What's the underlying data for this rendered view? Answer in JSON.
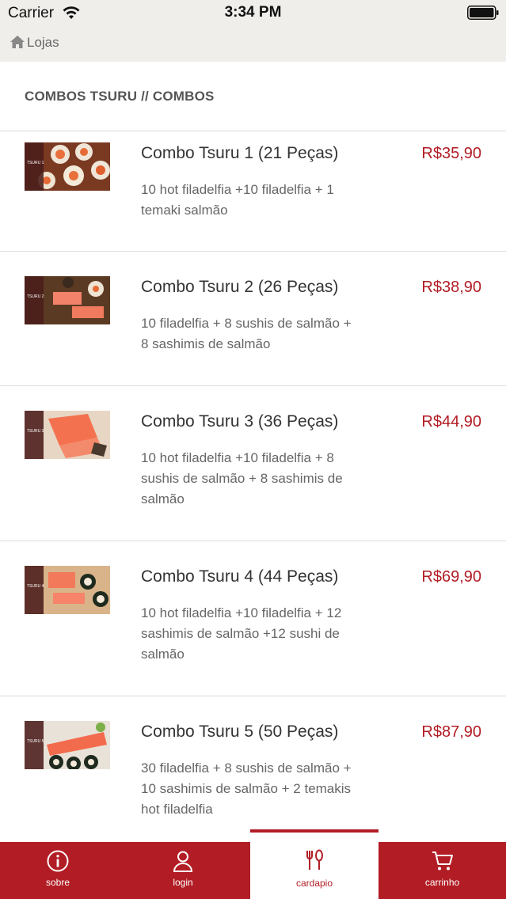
{
  "status_bar": {
    "carrier": "Carrier",
    "time": "3:34 PM"
  },
  "nav": {
    "back_label": "Lojas"
  },
  "section": {
    "title": "COMBOS TSURU // COMBOS"
  },
  "items": [
    {
      "name": "Combo Tsuru 1 (21 Peças)",
      "desc_lines": [
        "10 hot filadelfia +10 filadelfia + 1",
        "temaki salmão"
      ],
      "price": "R$35,90",
      "thumb_label": "TSURU 1"
    },
    {
      "name": "Combo Tsuru 2 (26 Peças)",
      "desc_lines": [
        "10 filadelfia + 8 sushis de salmão +",
        "8 sashimis de salmão"
      ],
      "price": "R$38,90",
      "thumb_label": "TSURU 2"
    },
    {
      "name": "Combo Tsuru 3 (36 Peças)",
      "desc_lines": [
        "10 hot filadelfia +10 filadelfia + 8",
        "sushis de salmão + 8 sashimis de",
        "salmão"
      ],
      "price": "R$44,90",
      "thumb_label": "TSURU 3"
    },
    {
      "name": "Combo Tsuru 4 (44 Peças)",
      "desc_lines": [
        "10 hot filadelfia +10 filadelfia + 12",
        "sashimis de salmão +12 sushi de",
        "salmão"
      ],
      "price": "R$69,90",
      "thumb_label": "TSURU 4"
    },
    {
      "name": "Combo Tsuru 5 (50 Peças)",
      "desc_lines": [
        "30 filadelfia + 8 sushis de salmão +",
        "10 sashimis de salmão + 2 temakis",
        "hot filadelfia"
      ],
      "price": "R$87,90",
      "thumb_label": "TSURU 5"
    }
  ],
  "tabs": [
    {
      "label": "sobre",
      "icon": "info-icon",
      "active": false
    },
    {
      "label": "login",
      "icon": "user-icon",
      "active": false
    },
    {
      "label": "cardapio",
      "icon": "cutlery-icon",
      "active": true
    },
    {
      "label": "carrinho",
      "icon": "cart-icon",
      "active": false
    }
  ],
  "colors": {
    "accent": "#b21d25",
    "bar_background": "#efeeea"
  }
}
